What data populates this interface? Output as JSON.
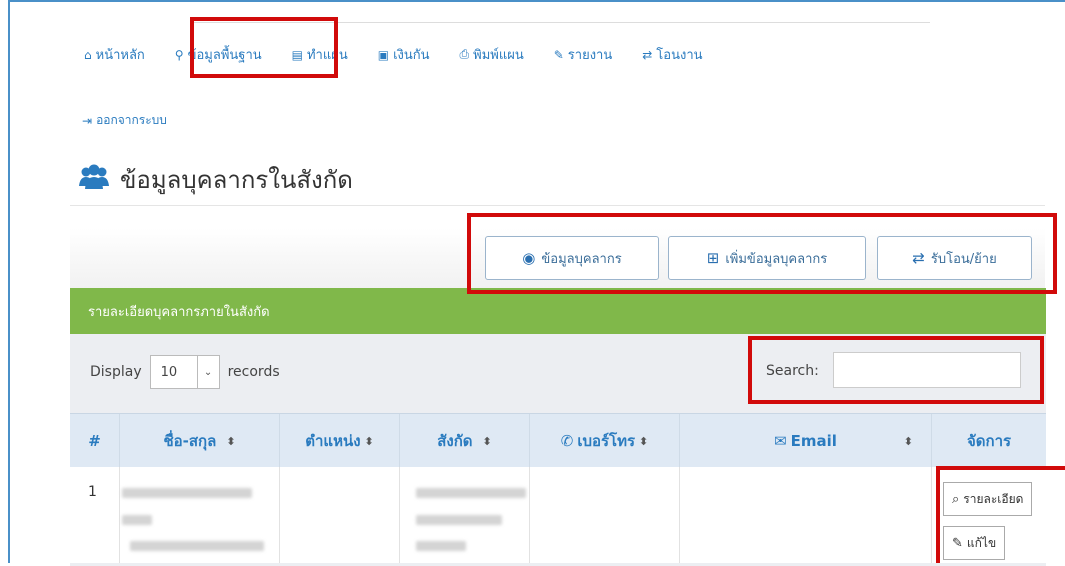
{
  "nav": {
    "items": [
      {
        "icon": "home-icon",
        "glyph": "⌂",
        "label": "หน้าหลัก"
      },
      {
        "icon": "map-marker-icon",
        "glyph": "⚲",
        "label": "ข้อมูลพื้นฐาน"
      },
      {
        "icon": "list-icon",
        "glyph": "▤",
        "label": "ทำแผน"
      },
      {
        "icon": "money-icon",
        "glyph": "▣",
        "label": "เงินกัน"
      },
      {
        "icon": "print-icon",
        "glyph": "⎙",
        "label": "พิมพ์แผน"
      },
      {
        "icon": "pencil-icon",
        "glyph": "✎",
        "label": "รายงาน"
      },
      {
        "icon": "exchange-icon",
        "glyph": "⇄",
        "label": "โอนงาน"
      }
    ],
    "logout": {
      "icon": "sign-out-icon",
      "glyph": "⇥",
      "label": "ออกจากระบบ"
    }
  },
  "page": {
    "title": "ข้อมูลบุคลากรในสังกัด",
    "title_icon": "users-icon"
  },
  "toolbar": {
    "buttons": [
      {
        "icon": "user-circle-icon",
        "glyph": "◉",
        "label": "ข้อมูลบุคลากร"
      },
      {
        "icon": "plus-square-icon",
        "glyph": "⊞",
        "label": "เพิ่มข้อมูลบุคลากร"
      },
      {
        "icon": "exchange-icon",
        "glyph": "⇄",
        "label": "รับโอน/ย้าย"
      }
    ]
  },
  "panel": {
    "heading": "รายละเอียดบุคลากรภายในสังกัด",
    "display_label": "Display",
    "page_size": "10",
    "records_label": "records",
    "search_label": "Search:",
    "search_value": ""
  },
  "table": {
    "columns": [
      {
        "label": "#",
        "sortable": false
      },
      {
        "label": "ชื่อ-สกุล",
        "sortable": true
      },
      {
        "label": "ตำแหน่ง",
        "sortable": true
      },
      {
        "label": "สังกัด",
        "sortable": true
      },
      {
        "label": "เบอร์โทร",
        "sortable": true,
        "icon": "phone-icon",
        "glyph": "✆"
      },
      {
        "label": "Email",
        "sortable": true,
        "icon": "envelope-icon",
        "glyph": "✉"
      },
      {
        "label": "จัดการ",
        "sortable": false
      }
    ],
    "rows": [
      {
        "num": "1",
        "detail_label": "รายละเอียด",
        "edit_label": "แก้ไข"
      }
    ]
  },
  "colors": {
    "link": "#2a7bbf",
    "panel_green": "#80b84a",
    "highlight": "#d10a0a"
  }
}
